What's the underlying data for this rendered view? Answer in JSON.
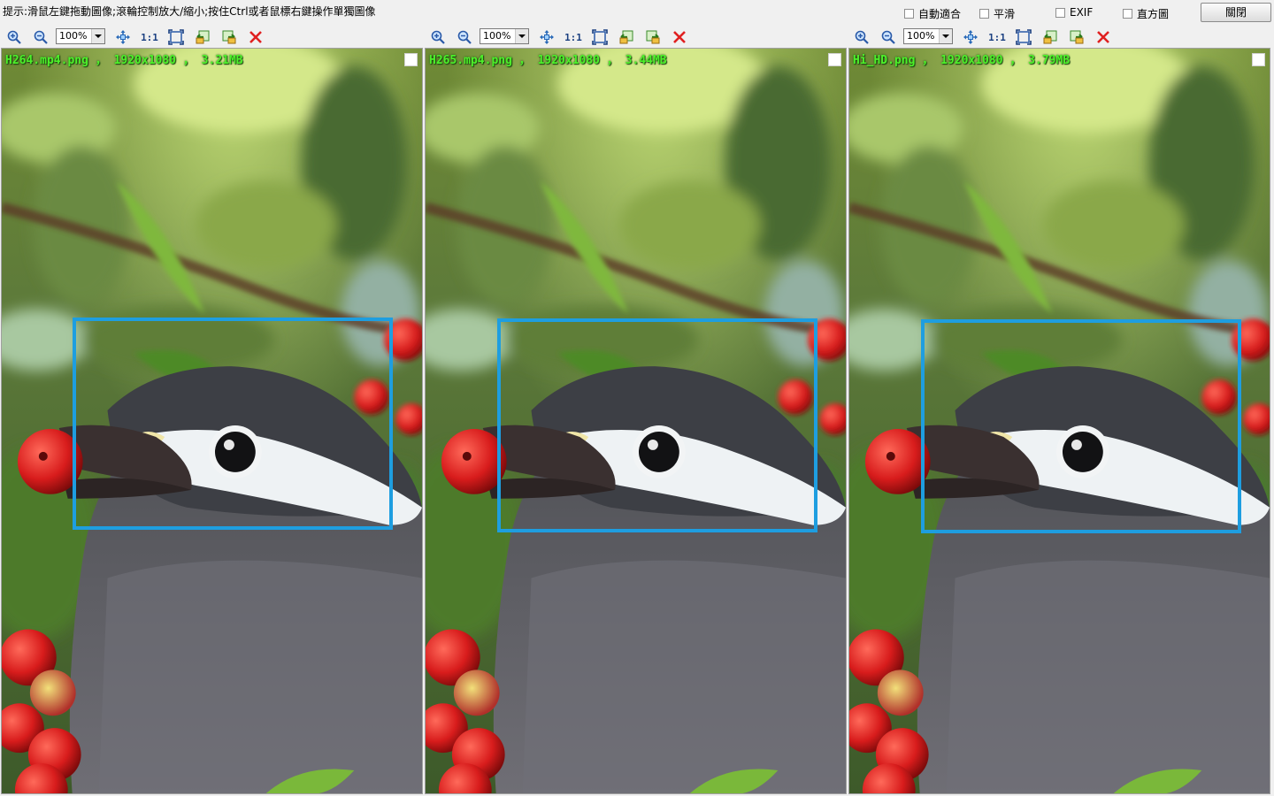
{
  "hint": "提示:滑鼠左鍵拖動圖像;滾輪控制放大/縮小;按住Ctrl或者鼠標右鍵操作單獨圖像",
  "options": [
    "自動適合",
    "平滑",
    "EXIF",
    "直方圖"
  ],
  "close_label": "關閉",
  "toolbar": {
    "zoom_value": "100%",
    "one_to_one": "1:1",
    "icons": [
      "zoom-in-icon",
      "zoom-out-icon",
      "fit-icon",
      "actual-size-icon",
      "fullscreen-icon",
      "previous-image-icon",
      "next-image-icon",
      "close-image-icon"
    ]
  },
  "panels": [
    {
      "label": "H264.mp4.png ， 1920x1080 ， 3.21MB"
    },
    {
      "label": "H265.mp4.png ， 1920x1080 ， 3.44MB"
    },
    {
      "label": "Hi_HD.png ， 1920x1080 ， 3.79MB"
    }
  ],
  "colors": {
    "label_green": "#4df02a",
    "highlight_blue": "#1e9ee0",
    "close_red": "#e02020"
  }
}
